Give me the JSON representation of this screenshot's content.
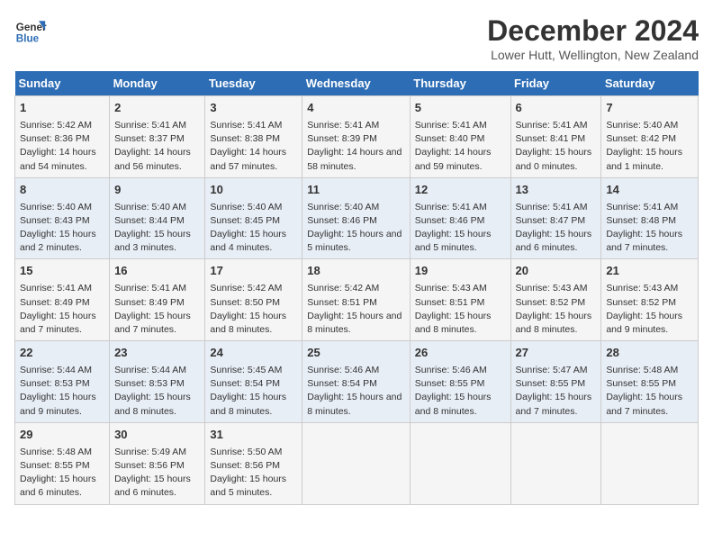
{
  "header": {
    "logo_line1": "General",
    "logo_line2": "Blue",
    "main_title": "December 2024",
    "subtitle": "Lower Hutt, Wellington, New Zealand"
  },
  "days_of_week": [
    "Sunday",
    "Monday",
    "Tuesday",
    "Wednesday",
    "Thursday",
    "Friday",
    "Saturday"
  ],
  "weeks": [
    [
      {
        "day": 1,
        "sunrise": "5:42 AM",
        "sunset": "8:36 PM",
        "daylight": "14 hours and 54 minutes."
      },
      {
        "day": 2,
        "sunrise": "5:41 AM",
        "sunset": "8:37 PM",
        "daylight": "14 hours and 56 minutes."
      },
      {
        "day": 3,
        "sunrise": "5:41 AM",
        "sunset": "8:38 PM",
        "daylight": "14 hours and 57 minutes."
      },
      {
        "day": 4,
        "sunrise": "5:41 AM",
        "sunset": "8:39 PM",
        "daylight": "14 hours and 58 minutes."
      },
      {
        "day": 5,
        "sunrise": "5:41 AM",
        "sunset": "8:40 PM",
        "daylight": "14 hours and 59 minutes."
      },
      {
        "day": 6,
        "sunrise": "5:41 AM",
        "sunset": "8:41 PM",
        "daylight": "15 hours and 0 minutes."
      },
      {
        "day": 7,
        "sunrise": "5:40 AM",
        "sunset": "8:42 PM",
        "daylight": "15 hours and 1 minute."
      }
    ],
    [
      {
        "day": 8,
        "sunrise": "5:40 AM",
        "sunset": "8:43 PM",
        "daylight": "15 hours and 2 minutes."
      },
      {
        "day": 9,
        "sunrise": "5:40 AM",
        "sunset": "8:44 PM",
        "daylight": "15 hours and 3 minutes."
      },
      {
        "day": 10,
        "sunrise": "5:40 AM",
        "sunset": "8:45 PM",
        "daylight": "15 hours and 4 minutes."
      },
      {
        "day": 11,
        "sunrise": "5:40 AM",
        "sunset": "8:46 PM",
        "daylight": "15 hours and 5 minutes."
      },
      {
        "day": 12,
        "sunrise": "5:41 AM",
        "sunset": "8:46 PM",
        "daylight": "15 hours and 5 minutes."
      },
      {
        "day": 13,
        "sunrise": "5:41 AM",
        "sunset": "8:47 PM",
        "daylight": "15 hours and 6 minutes."
      },
      {
        "day": 14,
        "sunrise": "5:41 AM",
        "sunset": "8:48 PM",
        "daylight": "15 hours and 7 minutes."
      }
    ],
    [
      {
        "day": 15,
        "sunrise": "5:41 AM",
        "sunset": "8:49 PM",
        "daylight": "15 hours and 7 minutes."
      },
      {
        "day": 16,
        "sunrise": "5:41 AM",
        "sunset": "8:49 PM",
        "daylight": "15 hours and 7 minutes."
      },
      {
        "day": 17,
        "sunrise": "5:42 AM",
        "sunset": "8:50 PM",
        "daylight": "15 hours and 8 minutes."
      },
      {
        "day": 18,
        "sunrise": "5:42 AM",
        "sunset": "8:51 PM",
        "daylight": "15 hours and 8 minutes."
      },
      {
        "day": 19,
        "sunrise": "5:43 AM",
        "sunset": "8:51 PM",
        "daylight": "15 hours and 8 minutes."
      },
      {
        "day": 20,
        "sunrise": "5:43 AM",
        "sunset": "8:52 PM",
        "daylight": "15 hours and 8 minutes."
      },
      {
        "day": 21,
        "sunrise": "5:43 AM",
        "sunset": "8:52 PM",
        "daylight": "15 hours and 9 minutes."
      }
    ],
    [
      {
        "day": 22,
        "sunrise": "5:44 AM",
        "sunset": "8:53 PM",
        "daylight": "15 hours and 9 minutes."
      },
      {
        "day": 23,
        "sunrise": "5:44 AM",
        "sunset": "8:53 PM",
        "daylight": "15 hours and 8 minutes."
      },
      {
        "day": 24,
        "sunrise": "5:45 AM",
        "sunset": "8:54 PM",
        "daylight": "15 hours and 8 minutes."
      },
      {
        "day": 25,
        "sunrise": "5:46 AM",
        "sunset": "8:54 PM",
        "daylight": "15 hours and 8 minutes."
      },
      {
        "day": 26,
        "sunrise": "5:46 AM",
        "sunset": "8:55 PM",
        "daylight": "15 hours and 8 minutes."
      },
      {
        "day": 27,
        "sunrise": "5:47 AM",
        "sunset": "8:55 PM",
        "daylight": "15 hours and 7 minutes."
      },
      {
        "day": 28,
        "sunrise": "5:48 AM",
        "sunset": "8:55 PM",
        "daylight": "15 hours and 7 minutes."
      }
    ],
    [
      {
        "day": 29,
        "sunrise": "5:48 AM",
        "sunset": "8:55 PM",
        "daylight": "15 hours and 6 minutes."
      },
      {
        "day": 30,
        "sunrise": "5:49 AM",
        "sunset": "8:56 PM",
        "daylight": "15 hours and 6 minutes."
      },
      {
        "day": 31,
        "sunrise": "5:50 AM",
        "sunset": "8:56 PM",
        "daylight": "15 hours and 5 minutes."
      },
      null,
      null,
      null,
      null
    ]
  ]
}
